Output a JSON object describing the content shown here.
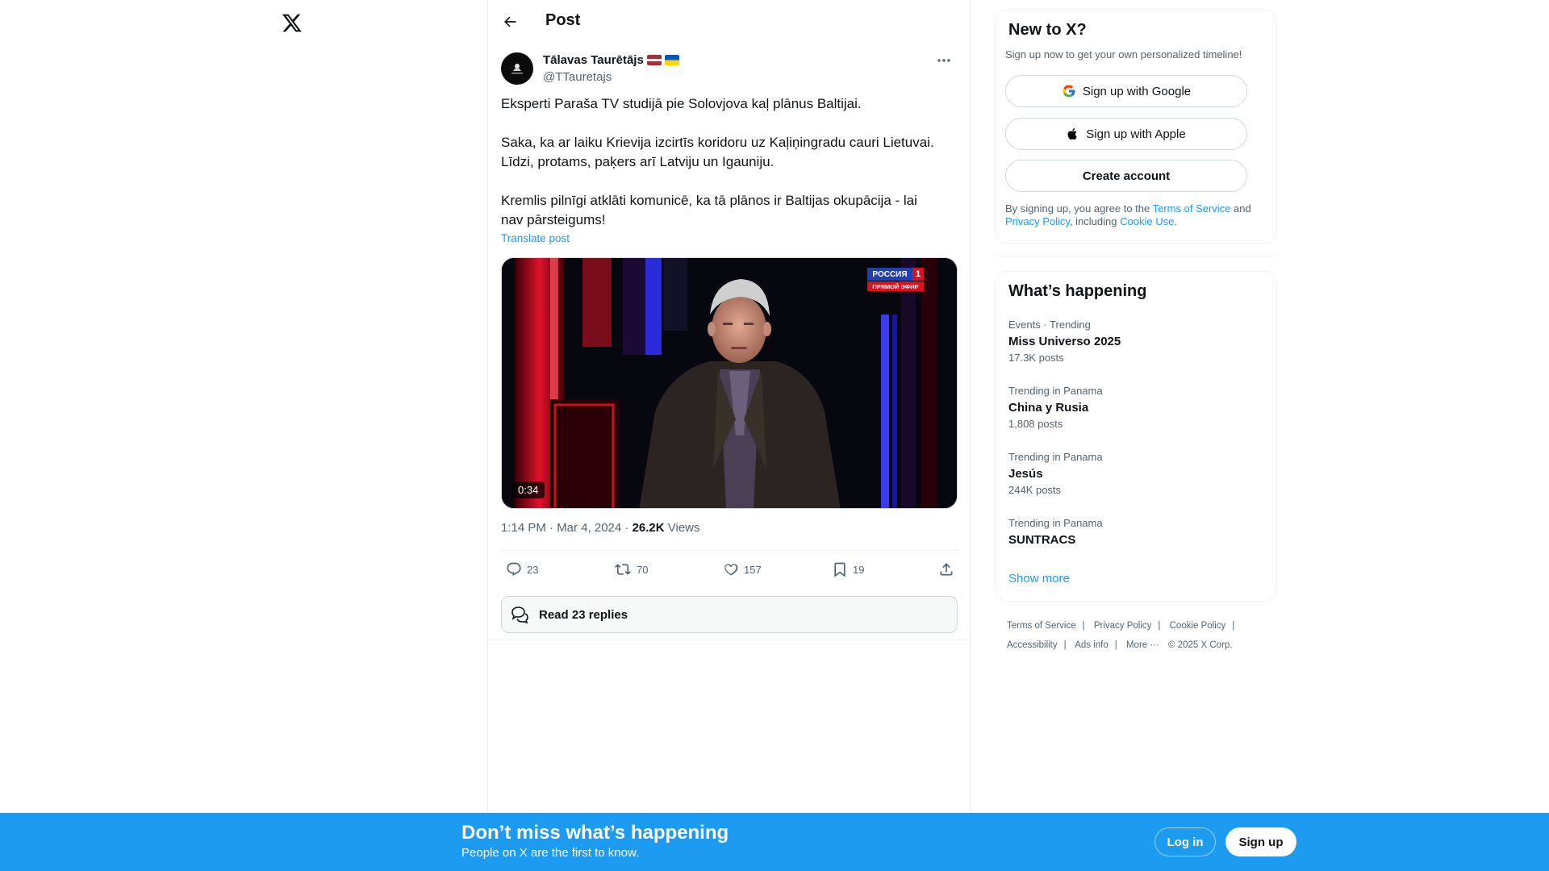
{
  "nav": {
    "logo_icon": "x-logo-icon"
  },
  "topbar": {
    "title": "Post",
    "back_icon": "back-arrow-icon"
  },
  "post": {
    "author_name": "Tālavas Taurētājs",
    "author_flags": [
      "latvia-flag-icon",
      "ukraine-flag-icon"
    ],
    "author_handle": "@TTauretajs",
    "paragraphs": [
      [
        "Eksperti Paraša TV studijā pie Solovjova kaļ plānus Baltijai."
      ],
      [
        "Saka, ka ar laiku Krievija izcirtīs koridoru uz Kaļiņingradu cauri Lietuvai.",
        "Līdzi, protams, paķers arī Latviju un Igauniju."
      ],
      [
        "Kremlis pilnīgi atklāti komunicē, ka tā plānos ir Baltijas okupācija - lai",
        "nav pārsteigums!"
      ]
    ],
    "translate_label": "Translate post",
    "video": {
      "duration": "0:34",
      "channel_logo_line1": "РОССИЯ",
      "channel_logo_num": "1",
      "channel_logo_line2": "ПРЯМОЙ ЭФИР"
    },
    "time_date": "1:14 PM · Mar 4, 2024 · ",
    "views_count": "26.2K",
    "views_label": " Views",
    "stats": {
      "replies": "23",
      "reposts": "70",
      "likes": "157",
      "bookmarks": "19"
    },
    "read_replies_label": "Read 23 replies"
  },
  "signup": {
    "title": "New to X?",
    "subtitle": "Sign up now to get your own personalized timeline!",
    "google_label": "Sign up with Google",
    "apple_label": "Sign up with Apple",
    "create_label": "Create account",
    "legal_prefix": "By signing up, you agree to the ",
    "tos_label": "Terms of Service",
    "legal_and": " and",
    "privacy_label": "Privacy Policy",
    "legal_including": ", including ",
    "cookie_label": "Cookie Use",
    "legal_end": "."
  },
  "trends": {
    "title": "What’s happening",
    "items": [
      {
        "context": "Events · Trending",
        "name": "Miss Universo 2025",
        "posts": "17.3K posts"
      },
      {
        "context": "Trending in Panama",
        "name": "China y Rusia",
        "posts": "1,808 posts"
      },
      {
        "context": "Trending in Panama",
        "name": "Jesús",
        "posts": "244K posts"
      },
      {
        "context": "Trending in Panama",
        "name": "SUNTRACS",
        "posts": ""
      }
    ],
    "show_more": "Show more"
  },
  "footer": {
    "links": [
      "Terms of Service",
      "Privacy Policy",
      "Cookie Policy",
      "Accessibility",
      "Ads info",
      "More ···"
    ],
    "copyright": "© 2025 X Corp."
  },
  "banner": {
    "title": "Don’t miss what’s happening",
    "subtitle": "People on X are the first to know.",
    "login_label": "Log in",
    "signup_label": "Sign up",
    "background": "#1d9bf0"
  },
  "colors": {
    "accent": "#1d9bf0",
    "text": "#0f1419",
    "secondary": "#536471",
    "border": "#cfd9de"
  }
}
